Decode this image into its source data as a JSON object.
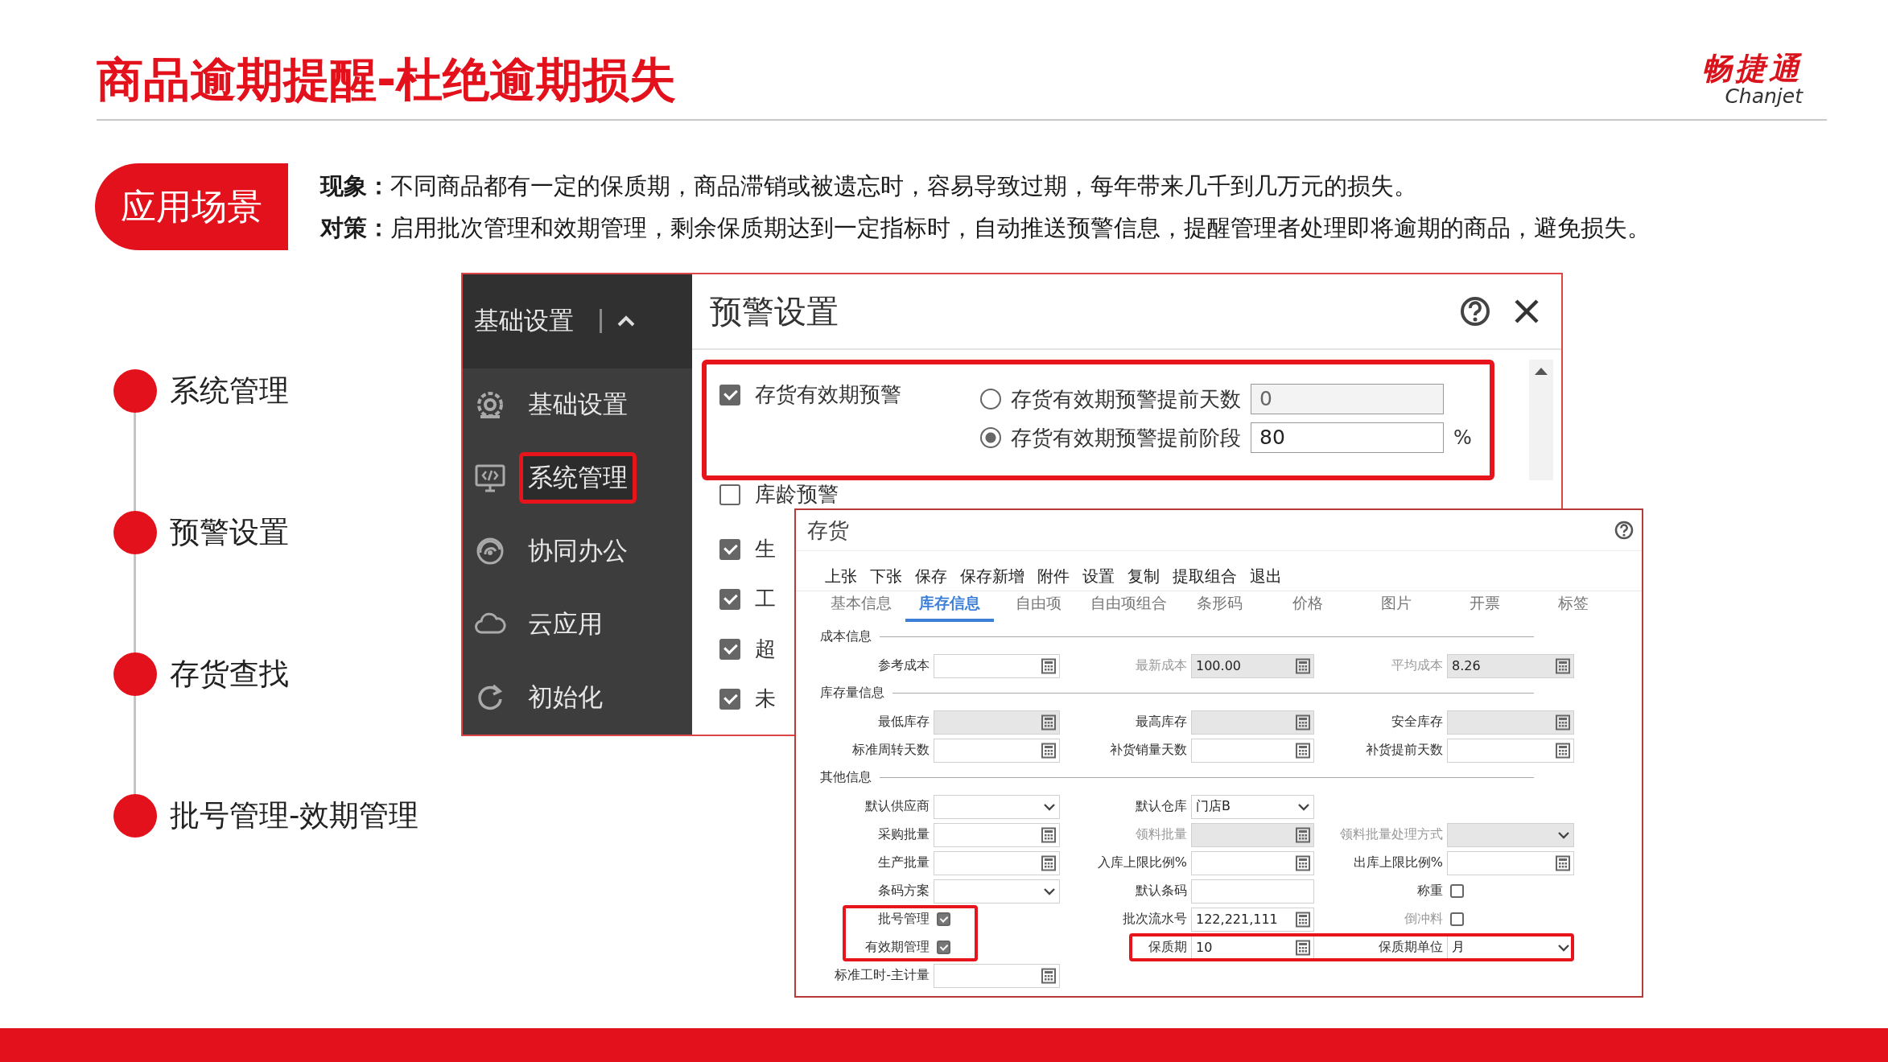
{
  "slide": {
    "title": "商品逾期提醒-杜绝逾期损失",
    "logo": {
      "name": "畅捷通",
      "latin": "Chanjet"
    }
  },
  "scenario": {
    "badge": "应用场景",
    "lines": [
      "**现象：**不同商品都有一定的保质期，商品滞销或被遗忘时，容易导致过期，每年带来几千到几万元的损失。",
      "**对策：**启用批次管理和效期管理，剩余保质期达到一定指标时，自动推送预警信息，提醒管理者处理即将逾期的商品，避免损失。"
    ]
  },
  "steps": [
    "系统管理",
    "预警设置",
    "存货查找",
    "批号管理-效期管理"
  ],
  "warning_window": {
    "title": "预警设置",
    "sidebar": {
      "header": "基础设置",
      "items": [
        {
          "label": "基础设置",
          "highlighted": false
        },
        {
          "label": "系统管理",
          "highlighted": true
        },
        {
          "label": "协同办公",
          "highlighted": false
        },
        {
          "label": "云应用",
          "highlighted": false
        },
        {
          "label": "初始化",
          "highlighted": false
        }
      ]
    },
    "options": [
      {
        "label": "存货有效期预警",
        "checked": true,
        "highlighted": true,
        "modes": [
          {
            "label": "存货有效期预警提前天数",
            "value": "0",
            "selected": false
          },
          {
            "label": "存货有效期预警提前阶段",
            "value": "80",
            "selected": true,
            "unit": "%"
          }
        ]
      },
      {
        "label": "库龄预警",
        "checked": false,
        "highlighted": false
      },
      {
        "label": "生",
        "checked": true,
        "highlighted": false
      },
      {
        "label": "工",
        "checked": true,
        "highlighted": false
      },
      {
        "label": "超",
        "checked": true,
        "highlighted": false
      },
      {
        "label": "未",
        "checked": true,
        "highlighted": false
      }
    ]
  },
  "inventory_window": {
    "title": "存货",
    "toolbar": [
      "上张",
      "下张",
      "保存",
      "保存新增",
      "附件",
      "设置",
      "复制",
      "提取组合",
      "退出"
    ],
    "tabs": [
      {
        "label": "基本信息",
        "selected": false
      },
      {
        "label": "库存信息",
        "selected": true
      },
      {
        "label": "自由项",
        "selected": false
      },
      {
        "label": "自由项组合",
        "selected": false
      },
      {
        "label": "条形码",
        "selected": false
      },
      {
        "label": "价格",
        "selected": false
      },
      {
        "label": "图片",
        "selected": false
      },
      {
        "label": "开票",
        "selected": false
      },
      {
        "label": "标签",
        "selected": false
      }
    ],
    "sections": [
      {
        "title": "成本信息",
        "rows": [
          {
            "cells": [
              {
                "label": "参考成本",
                "kind": "calc"
              },
              {
                "label": "最新成本",
                "kind": "calc",
                "value": "100.00",
                "readonly": true,
                "disabled": true
              },
              {
                "label": "平均成本",
                "kind": "calc",
                "value": "8.26",
                "readonly": true,
                "disabled": true
              }
            ]
          }
        ]
      },
      {
        "title": "库存量信息",
        "rows": [
          {
            "cells": [
              {
                "label": "最低库存",
                "kind": "calc",
                "readonly": true
              },
              {
                "label": "最高库存",
                "kind": "calc",
                "readonly": true
              },
              {
                "label": "安全库存",
                "kind": "calc",
                "readonly": true
              }
            ]
          },
          {
            "cells": [
              {
                "label": "标准周转天数",
                "kind": "calc"
              },
              {
                "label": "补货销量天数",
                "kind": "calc"
              },
              {
                "label": "补货提前天数",
                "kind": "calc"
              }
            ]
          }
        ]
      },
      {
        "title": "其他信息",
        "rows": [
          {
            "cells": [
              {
                "label": "默认供应商",
                "kind": "select"
              },
              {
                "label": "默认仓库",
                "kind": "select",
                "value": "门店B"
              }
            ]
          },
          {
            "cells": [
              {
                "label": "采购批量",
                "kind": "calc"
              },
              {
                "label": "领料批量",
                "kind": "calc",
                "readonly": true,
                "disabled": true
              },
              {
                "label": "领料批量处理方式",
                "kind": "select",
                "readonly": true,
                "disabled": true
              }
            ]
          },
          {
            "cells": [
              {
                "label": "生产批量",
                "kind": "calc"
              },
              {
                "label": "入库上限比例%",
                "kind": "calc"
              },
              {
                "label": "出库上限比例%",
                "kind": "calc"
              }
            ]
          },
          {
            "cells": [
              {
                "label": "条码方案",
                "kind": "select"
              },
              {
                "label": "默认条码",
                "kind": "text"
              },
              {
                "label": "称重",
                "kind": "check",
                "checked": false
              }
            ]
          },
          {
            "cells": [
              {
                "label": "批号管理",
                "kind": "check",
                "checked": true
              },
              {
                "label": "批次流水号",
                "kind": "calc",
                "value": "122,221,111"
              },
              {
                "label": "倒冲料",
                "kind": "check",
                "checked": false,
                "disabled": true
              }
            ]
          },
          {
            "cells": [
              {
                "label": "有效期管理",
                "kind": "check",
                "checked": true
              },
              {
                "label": "保质期",
                "kind": "calc",
                "value": "10"
              },
              {
                "label": "保质期单位",
                "kind": "select",
                "value": "月"
              }
            ]
          },
          {
            "cells": [
              {
                "label": "标准工时-主计量",
                "kind": "calc"
              }
            ]
          }
        ]
      }
    ]
  }
}
